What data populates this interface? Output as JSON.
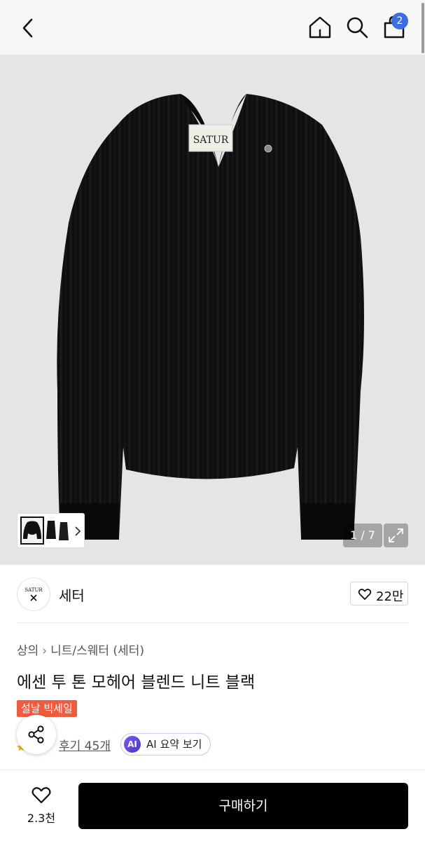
{
  "header": {
    "back_icon": "chevron-left-icon",
    "home_icon": "home-icon",
    "search_icon": "search-icon",
    "cart_icon": "shopping-bag-icon",
    "cart_count": "2",
    "badge_color": "#3b6fe0"
  },
  "gallery": {
    "image_label": "SATUR",
    "counter": "1 / 7",
    "expand_icon": "expand-icon",
    "thumbnail_next_icon": "chevron-right-icon"
  },
  "brand": {
    "logo_text": "SATUR",
    "name": "세터",
    "like_icon": "heart-icon",
    "like_count": "22만"
  },
  "product": {
    "breadcrumb": [
      "상의",
      "니트/스웨터 (세터)"
    ],
    "title": "에센 투 톤 모헤어 블렌드 니트 블랙",
    "sale_tag": "설날 빅세일",
    "sale_color": "#ee5b3e",
    "reviews": "후기 45개",
    "ai_badge": "AI",
    "ai_summary": "AI 요약 보기"
  },
  "bottom_bar": {
    "wish_icon": "heart-icon",
    "wish_count": "2.3천",
    "buy_label": "구매하기"
  }
}
